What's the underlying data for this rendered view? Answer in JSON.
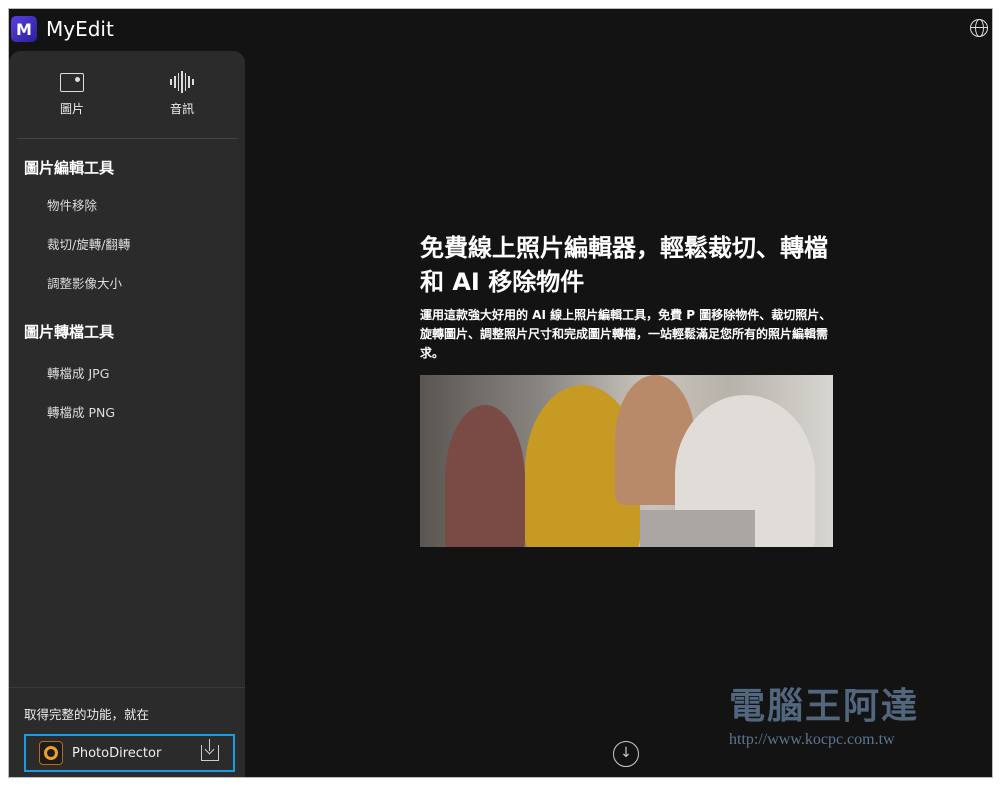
{
  "header": {
    "logo_letter": "M",
    "brand": "MyEdit",
    "language_icon": "globe-icon"
  },
  "sidebar": {
    "modes": [
      {
        "label": "圖片",
        "icon": "image-icon"
      },
      {
        "label": "音訊",
        "icon": "audio-wave-icon"
      }
    ],
    "sections": [
      {
        "title": "圖片編輯工具",
        "items": [
          "物件移除",
          "裁切/旋轉/翻轉",
          "調整影像大小"
        ]
      },
      {
        "title": "圖片轉檔工具",
        "items": [
          "轉檔成 JPG",
          "轉檔成 PNG"
        ]
      }
    ],
    "promo": {
      "text": "取得完整的功能，就在",
      "app_name": "PhotoDirector",
      "download_icon": "download-icon"
    }
  },
  "hero": {
    "title": "免費線上照片編輯器，輕鬆裁切、轉檔和 AI 移除物件",
    "subtitle": "運用這款強大好用的 AI 線上照片編輯工具，免費 P 圖移除物件、裁切照片、旋轉圖片、調整照片尺寸和完成圖片轉檔，一站輕鬆滿足您所有的照片編輯需求。"
  },
  "scroll_icon": "arrow-down-circle-icon",
  "watermark": {
    "name": "電腦王阿達",
    "url": "http://www.kocpc.com.tw"
  }
}
